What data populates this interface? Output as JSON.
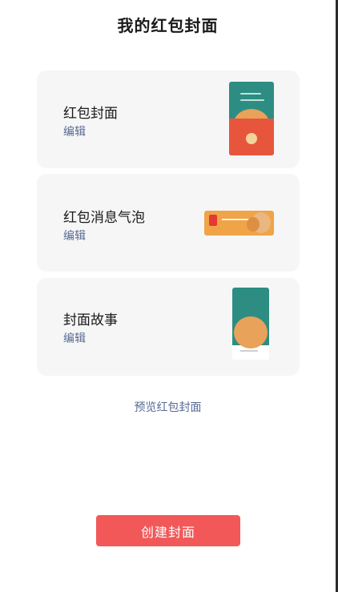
{
  "page": {
    "title": "我的红包封面"
  },
  "cards": [
    {
      "title": "红包封面",
      "action": "编辑",
      "thumbnail": "red-envelope-cover-thumbnail"
    },
    {
      "title": "红包消息气泡",
      "action": "编辑",
      "thumbnail": "message-bubble-thumbnail"
    },
    {
      "title": "封面故事",
      "action": "编辑",
      "thumbnail": "cover-story-thumbnail"
    }
  ],
  "preview_link": "预览红包封面",
  "create_button": "创建封面",
  "colors": {
    "card_background": "#f6f6f6",
    "link_blue": "#576b95",
    "primary_red": "#f25858",
    "thumbnail_teal": "#2d8d82",
    "thumbnail_orange": "#f0a447"
  }
}
